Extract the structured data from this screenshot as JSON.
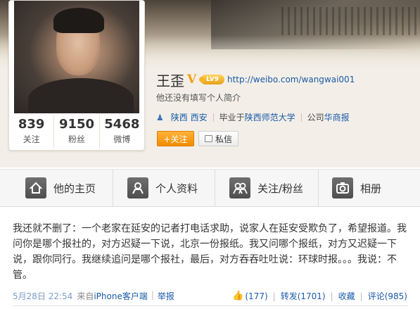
{
  "profile": {
    "name": "王歪",
    "verified_badge": "V",
    "level_badge": "LV9",
    "url": "http://weibo.com/wangwai001",
    "bio": "他还没有填写个人简介",
    "location": "陕西 西安",
    "education_prefix": "毕业于",
    "education": "陕西师范大学",
    "company_prefix": "公司",
    "company": "华商报",
    "person_icon": "person-icon"
  },
  "stats": [
    {
      "num": "839",
      "label": "关注"
    },
    {
      "num": "9150",
      "label": "粉丝"
    },
    {
      "num": "5468",
      "label": "微博"
    }
  ],
  "buttons": {
    "follow": "+关注",
    "message": "私信"
  },
  "tabs": [
    {
      "label": "他的主页",
      "icon": "home-icon"
    },
    {
      "label": "个人资料",
      "icon": "profile-icon"
    },
    {
      "label": "关注/粉丝",
      "icon": "people-icon"
    },
    {
      "label": "相册",
      "icon": "camera-icon"
    }
  ],
  "post": {
    "text": "我还就不删了：一个老家在延安的记者打电话求助，说家人在延安受欺负了，希望报道。我问你是哪个报社的，对方迟疑一下说，北京一份报纸。我又问哪个报纸，对方又迟疑一下说，跟你同行。我继续追问是哪个报社，最后，对方吞吞吐吐说：环球时报。。。我说：不管。",
    "time": "5月28日 22:54",
    "from_prefix": "来自",
    "source": "iPhone客户端",
    "report": "举报",
    "likes": "(177)",
    "repost": "转发(1701)",
    "favorite": "收藏",
    "comment": "评论(985)"
  },
  "colors": {
    "link": "#1a5aa8",
    "follow_button": "#f08c00",
    "badge_gold": "#f0a000"
  }
}
